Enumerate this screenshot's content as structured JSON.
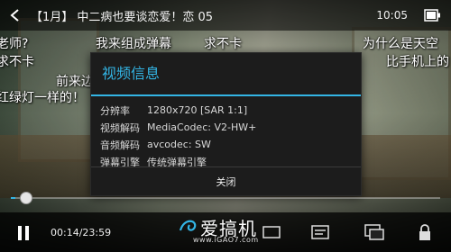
{
  "top_bar": {
    "title": "【1月】 中二病也要谈恋爱！恋 05",
    "clock": "10:05"
  },
  "danmaku": [
    "老师?",
    "我来组成弹幕",
    "求不卡",
    "为什么是天空",
    "求不卡",
    "比手机上的",
    "前来边",
    "红绿灯一样的！"
  ],
  "dialog": {
    "title": "视频信息",
    "rows": [
      {
        "label": "分辨率",
        "value": "1280x720 [SAR 1:1]"
      },
      {
        "label": "视频解码",
        "value": "MediaCodec: V2-HW+"
      },
      {
        "label": "音频解码",
        "value": "avcodec: SW"
      },
      {
        "label": "弹幕引擎",
        "value": "传统弹幕引擎"
      }
    ],
    "close_label": "关闭"
  },
  "player": {
    "time": "00:14/23:59",
    "progress": 0.01
  },
  "watermark": {
    "brand": "爱搞机",
    "url": "www.iGAO7.com"
  },
  "colors": {
    "accent": "#33b5e5"
  }
}
